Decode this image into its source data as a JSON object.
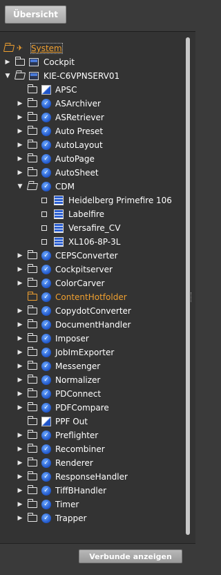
{
  "header": {
    "overview_button": "Übersicht"
  },
  "tree": {
    "root": {
      "label": "System"
    },
    "cockpit": {
      "label": "Cockpit"
    },
    "server": {
      "label": "KIE-C6VPNSERV01"
    },
    "services_before_cdm": [
      {
        "label": "APSC"
      },
      {
        "label": "ASArchiver"
      },
      {
        "label": "ASRetriever"
      },
      {
        "label": "Auto Preset"
      },
      {
        "label": "AutoLayout"
      },
      {
        "label": "AutoPage"
      },
      {
        "label": "AutoSheet"
      }
    ],
    "cdm": {
      "label": "CDM",
      "devices": [
        {
          "label": "Heidelberg Primefire 106"
        },
        {
          "label": "Labelfire"
        },
        {
          "label": "Versafire_CV"
        },
        {
          "label": "XL106-8P-3L"
        }
      ]
    },
    "services_after_cdm": [
      {
        "label": "CEPSConverter"
      },
      {
        "label": "Cockpitserver"
      },
      {
        "label": "ColorCarver"
      },
      {
        "label": "ContentHotfolder"
      },
      {
        "label": "CopydotConverter"
      },
      {
        "label": "DocumentHandler"
      },
      {
        "label": "Imposer"
      },
      {
        "label": "JobImExporter"
      },
      {
        "label": "Messenger"
      },
      {
        "label": "Normalizer"
      },
      {
        "label": "PDConnect"
      },
      {
        "label": "PDFCompare"
      },
      {
        "label": "PPF Out"
      },
      {
        "label": "Preflighter"
      },
      {
        "label": "Recombiner"
      },
      {
        "label": "Renderer"
      },
      {
        "label": "ResponseHandler"
      },
      {
        "label": "TiffBHandler"
      },
      {
        "label": "Timer"
      },
      {
        "label": "Trapper"
      }
    ]
  },
  "footer": {
    "show_groups_button": "Verbunde anzeigen"
  },
  "colors": {
    "highlight": "#f0a030",
    "service_blue": "#1f55c9",
    "background": "#333333"
  },
  "icons": {
    "collapsed": "triangle-right",
    "expanded": "triangle-down",
    "folder": "folder-icon",
    "service": "service-icon",
    "device": "device-icon"
  }
}
